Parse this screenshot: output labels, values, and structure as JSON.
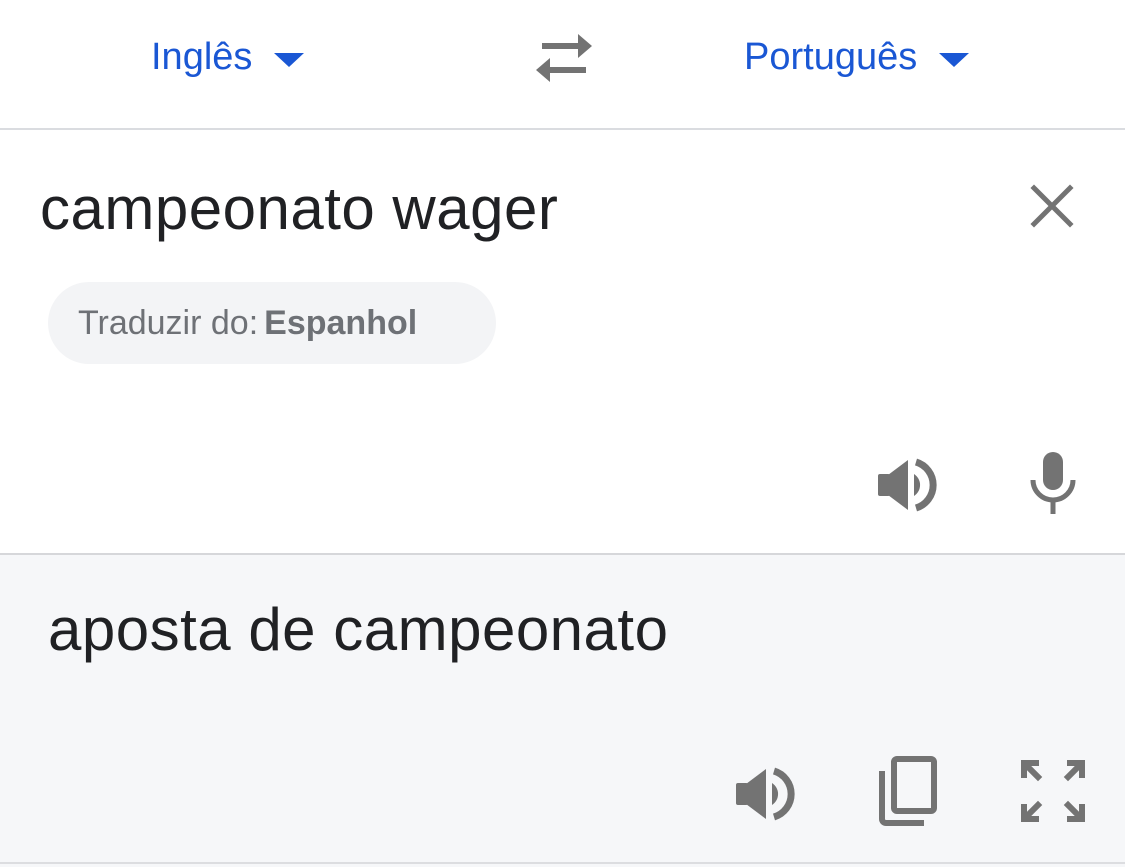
{
  "language_bar": {
    "source_language": "Inglês",
    "target_language": "Português",
    "swap_icon": "swap-arrows-icon",
    "caret_icon": "caret-down-icon"
  },
  "source": {
    "text": "campeonato wager",
    "clear_icon": "close-icon",
    "detect_prefix": "Traduzir do:",
    "detect_language": "Espanhol",
    "speaker_icon": "speaker-icon",
    "mic_icon": "microphone-icon"
  },
  "result": {
    "text": "aposta de campeonato",
    "speaker_icon": "speaker-icon",
    "copy_icon": "copy-icon",
    "fullscreen_icon": "fullscreen-icon"
  },
  "colors": {
    "accent": "#1a57d4",
    "icon_gray": "#737373",
    "result_bg": "#f6f7f9",
    "chip_bg": "#f3f4f6"
  }
}
